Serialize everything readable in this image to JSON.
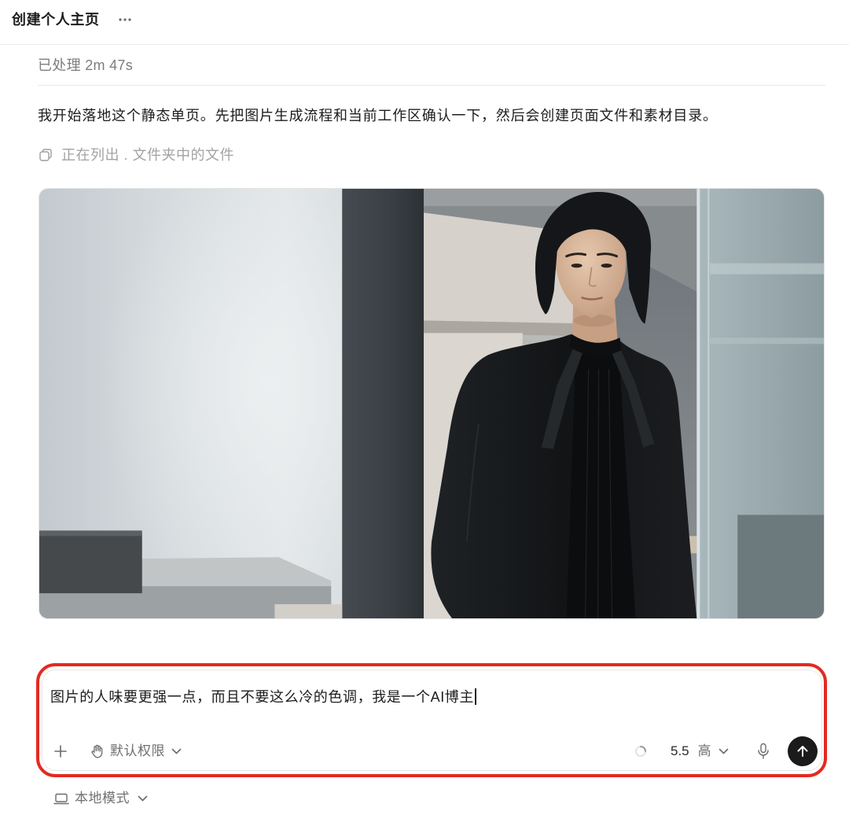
{
  "header": {
    "title": "创建个人主页",
    "more_icon": "more-icon"
  },
  "thread": {
    "processed_label": "已处理 2m 47s",
    "message": "我开始落地这个静态单页。先把图片生成流程和当前工作区确认一下，然后会创建页面文件和素材目录。",
    "status_icon": "files-icon",
    "status_text": "正在列出 . 文件夹中的文件"
  },
  "composer": {
    "input_value": "图片的人味要更强一点，而且不要这么冷的色调，我是一个AI博主",
    "add_icon": "plus-icon",
    "permission_icon": "hand-icon",
    "permission_label": "默认权限",
    "permission_chevron": "chevron-down-icon",
    "loading_icon": "spinner-icon",
    "model_version": "5.5",
    "reasoning_level": "高",
    "model_chevron": "chevron-down-icon",
    "mic_icon": "mic-icon",
    "send_icon": "arrow-up-icon"
  },
  "footer": {
    "mode_icon": "laptop-icon",
    "mode_label": "本地模式",
    "mode_chevron": "chevron-down-icon"
  },
  "colors": {
    "highlight": "#e42a20",
    "send_button": "#1b1b1b",
    "text": "#1c1c1c",
    "muted_text": "#7d7d7d"
  }
}
